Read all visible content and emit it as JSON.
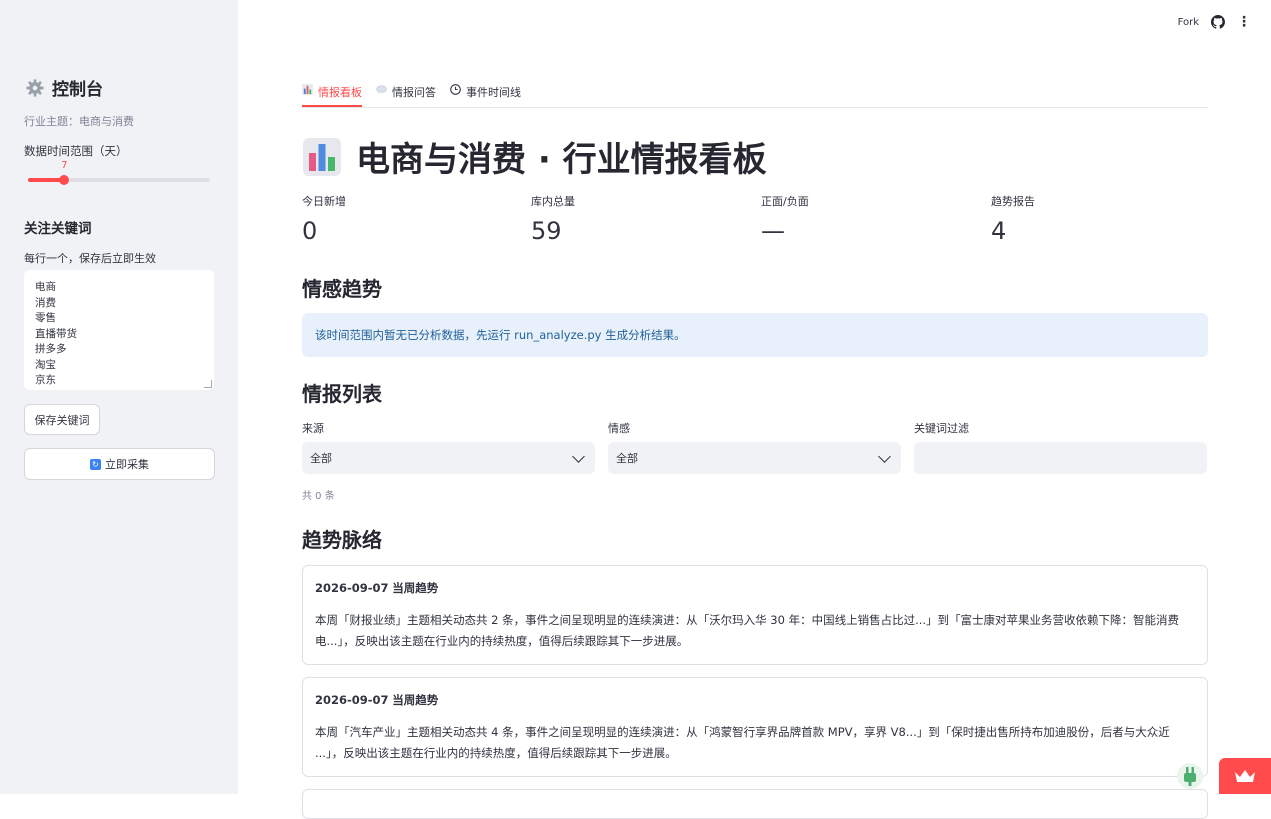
{
  "sidebar": {
    "title": "控制台",
    "topic": "行业主题：电商与消费",
    "range_label": "数据时间范围（天）",
    "range_value": "7",
    "range_fraction": 0.2,
    "keywords_title": "关注关键词",
    "keywords_hint": "每行一个，保存后立即生效",
    "keywords": [
      "电商",
      "消费",
      "零售",
      "直播带货",
      "拼多多",
      "淘宝",
      "京东"
    ],
    "save_label": "保存关键词",
    "collect_label": "立即采集"
  },
  "header": {
    "fork_label": "Fork"
  },
  "tabs": [
    {
      "label": "情报看板",
      "icon": "bar-chart-icon",
      "active": true
    },
    {
      "label": "情报问答",
      "icon": "speech-bubble-icon",
      "active": false
    },
    {
      "label": "事件时间线",
      "icon": "clock-icon",
      "active": false
    }
  ],
  "page_title": "电商与消费 · 行业情报看板",
  "metrics": [
    {
      "label": "今日新增",
      "value": "0"
    },
    {
      "label": "库内总量",
      "value": "59"
    },
    {
      "label": "正面/负面",
      "value": "—"
    },
    {
      "label": "趋势报告",
      "value": "4"
    }
  ],
  "sentiment": {
    "title": "情感趋势",
    "info": "该时间范围内暂无已分析数据，先运行 run_analyze.py 生成分析结果。"
  },
  "intel_list": {
    "title": "情报列表",
    "filters": {
      "source_label": "来源",
      "source_value": "全部",
      "sentiment_label": "情感",
      "sentiment_value": "全部",
      "keyword_label": "关键词过滤",
      "keyword_value": ""
    },
    "count_text": "共 0 条"
  },
  "trends": {
    "title": "趋势脉络",
    "cards": [
      {
        "date": "2026-09-07",
        "tag": "当周趋势",
        "body": "本周「财报业绩」主题相关动态共 2 条，事件之间呈现明显的连续演进：从「沃尔玛入华 30 年：中国线上销售占比过...」到「富士康对苹果业务营收依赖下降：智能消费电...」，反映出该主题在行业内的持续热度，值得后续跟踪其下一步进展。"
      },
      {
        "date": "2026-09-07",
        "tag": "当周趋势",
        "body": "本周「汽车产业」主题相关动态共 4 条，事件之间呈现明显的连续演进：从「鸿蒙智行享界品牌首款 MPV，享界 V8...」到「保时捷出售所持布加迪股份，后者与大众近 ...」，反映出该主题在行业内的持续热度，值得后续跟踪其下一步进展。"
      }
    ]
  },
  "colors": {
    "accent": "#ff4b4b",
    "sidebar_bg": "#f0f2f6",
    "info_bg": "#e8f1fb",
    "info_text": "#1f5f99"
  }
}
